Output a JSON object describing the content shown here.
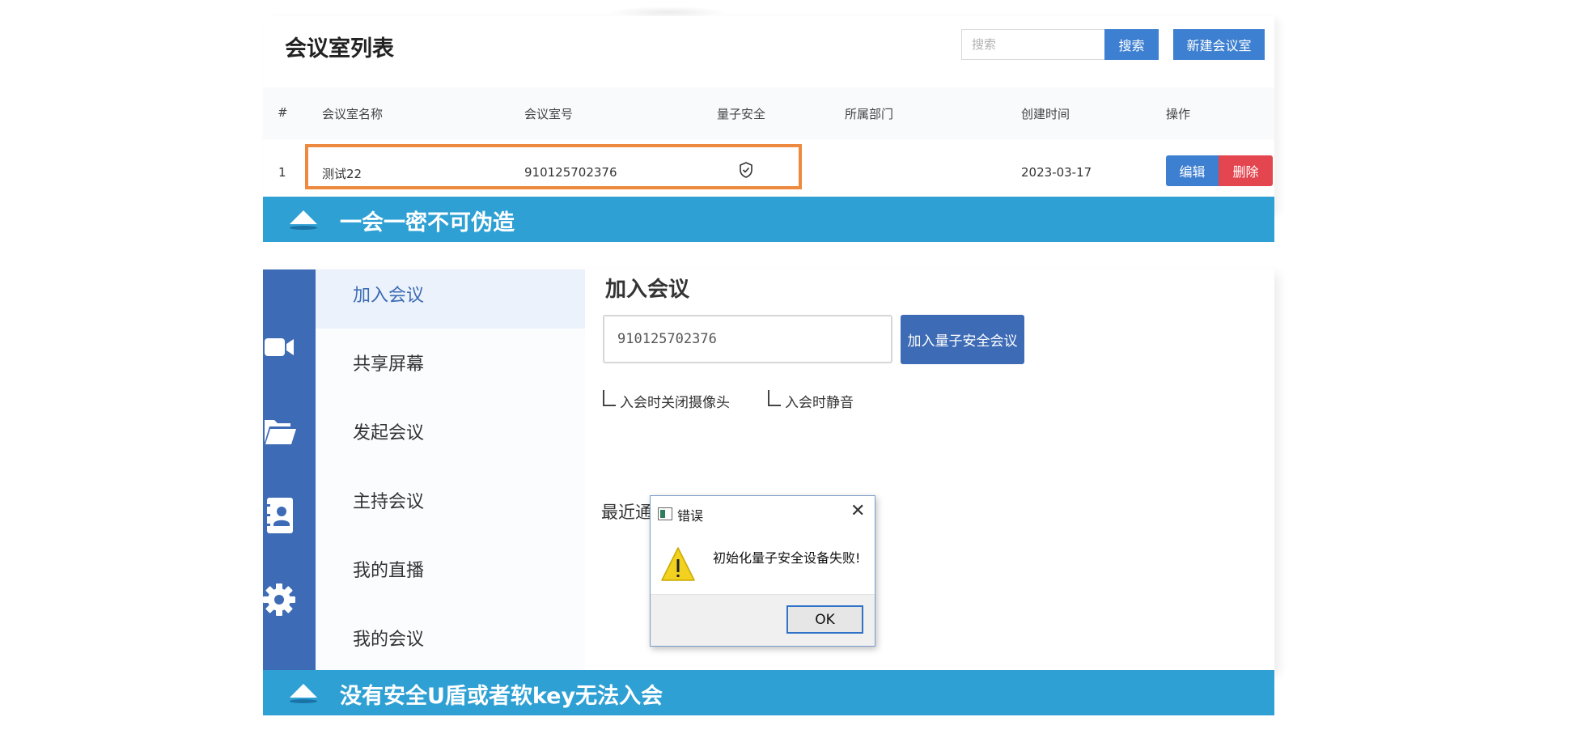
{
  "room_list": {
    "title": "会议室列表",
    "search_placeholder": "搜索",
    "search_label": "搜索",
    "new_room_label": "新建会议室",
    "columns": [
      "#",
      "会议室名称",
      "会议室号",
      "量子安全",
      "所属部门",
      "创建时间",
      "操作"
    ],
    "rows": [
      {
        "index": "1",
        "name": "测试22",
        "number": "910125702376",
        "quantum_secure": "shield-check-icon",
        "department": "",
        "created": "2023-03-17",
        "edit_label": "编辑",
        "delete_label": "删除"
      }
    ],
    "highlight_color": "#ed8a3f"
  },
  "captions": {
    "first": "一会一密不可伪造",
    "second": "没有安全U盾或者软key无法入会"
  },
  "app": {
    "rail_icons": [
      "video-camera-icon",
      "folder-icon",
      "contacts-icon",
      "gear-icon"
    ],
    "menu": [
      {
        "label": "加入会议",
        "active": true
      },
      {
        "label": "共享屏幕"
      },
      {
        "label": "发起会议"
      },
      {
        "label": "主持会议"
      },
      {
        "label": "我的直播"
      },
      {
        "label": "我的会议"
      }
    ],
    "join": {
      "title": "加入会议",
      "room_value": "910125702376",
      "button_label": "加入量子安全会议",
      "option_camera_off": "入会时关闭摄像头",
      "option_mute": "入会时静音",
      "recent_label": "最近通"
    }
  },
  "dialog": {
    "title": "错误",
    "message": "初始化量子安全设备失败!",
    "ok_label": "OK"
  },
  "colors": {
    "primary": "#3d7fd0",
    "danger": "#e4464f",
    "caption_bar": "#2ea0d4",
    "rail": "#3d6bb5"
  }
}
